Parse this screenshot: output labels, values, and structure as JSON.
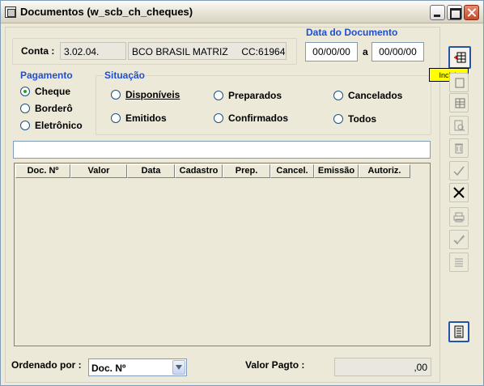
{
  "window": {
    "title": "Documentos (w_scb_ch_cheques)"
  },
  "conta": {
    "label": "Conta :",
    "code": "3.02.04.",
    "name": "BCO BRASIL MATRIZ     CC:61964"
  },
  "data_documento": {
    "title": "Data do Documento",
    "from": "00/00/00",
    "separator": "a",
    "to": "00/00/00"
  },
  "pagamento": {
    "title": "Pagamento",
    "options": [
      "Cheque",
      "Borderô",
      "Eletrônico"
    ],
    "selected": "Cheque"
  },
  "situacao": {
    "title": "Situação",
    "options": [
      "Disponíveis",
      "Preparados",
      "Cancelados",
      "Emitidos",
      "Confirmados",
      "Todos"
    ]
  },
  "search": {
    "value": ""
  },
  "grid": {
    "columns": [
      "Doc. Nº",
      "Valor",
      "Data",
      "Cadastro",
      "Prep.",
      "Cancel.",
      "Emissão",
      "Autoriz."
    ]
  },
  "toolbar": {
    "tooltip": "Incluir",
    "icons": [
      "include-icon",
      "edit-icon",
      "list-icon",
      "preview-icon",
      "trash-icon",
      "check-icon",
      "cancel-x-icon",
      "print-icon",
      "confirm-icon",
      "lines-icon",
      "report-icon"
    ]
  },
  "footer": {
    "order_label": "Ordenado por :",
    "order_value": "Doc. Nº",
    "valor_label": "Valor Pagto :",
    "valor_value": ",00"
  }
}
